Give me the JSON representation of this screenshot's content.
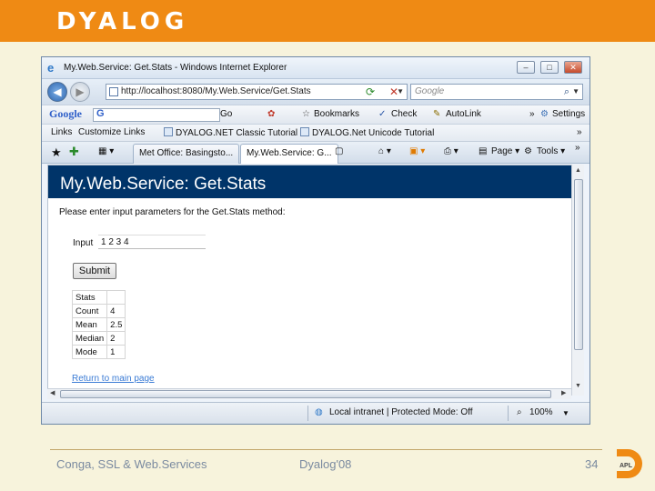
{
  "slide": {
    "logo": "DYALOG",
    "footer_left": "Conga, SSL & Web.Services",
    "footer_center": "Dyalog'08",
    "page_number": "34",
    "apl_badge": "APL",
    "accent_color": "#ef8a14"
  },
  "browser": {
    "window_title": "My.Web.Service: Get.Stats - Windows Internet Explorer",
    "address": "http://localhost:8080/My.Web.Service/Get.Stats",
    "search_placeholder": "Google",
    "toolbar": {
      "google_label": "Google",
      "go_label": "Go",
      "bookmarks": "Bookmarks",
      "check": "Check",
      "autolink": "AutoLink",
      "settings": "Settings"
    },
    "links": {
      "label": "Links",
      "items": [
        "Customize Links",
        "DYALOG.NET Classic Tutorial",
        "DYALOG.Net Unicode Tutorial"
      ]
    },
    "tabs": [
      "Met Office: Basingsto...",
      "My.Web.Service: G..."
    ],
    "tools": {
      "page": "Page",
      "tools": "Tools"
    },
    "status": {
      "zone": "Local intranet | Protected Mode: Off",
      "zoom": "100%"
    }
  },
  "page": {
    "banner_title": "My.Web.Service: Get.Stats",
    "instructions": "Please enter input parameters for the Get.Stats method:",
    "input_label": "Input",
    "input_value": "1 2 3 4",
    "submit_label": "Submit",
    "stats": [
      {
        "key": "Stats",
        "value": ""
      },
      {
        "key": "Count",
        "value": "4"
      },
      {
        "key": "Mean",
        "value": "2.5"
      },
      {
        "key": "Median",
        "value": "2"
      },
      {
        "key": "Mode",
        "value": "1"
      }
    ],
    "return_link": "Return to main page"
  }
}
